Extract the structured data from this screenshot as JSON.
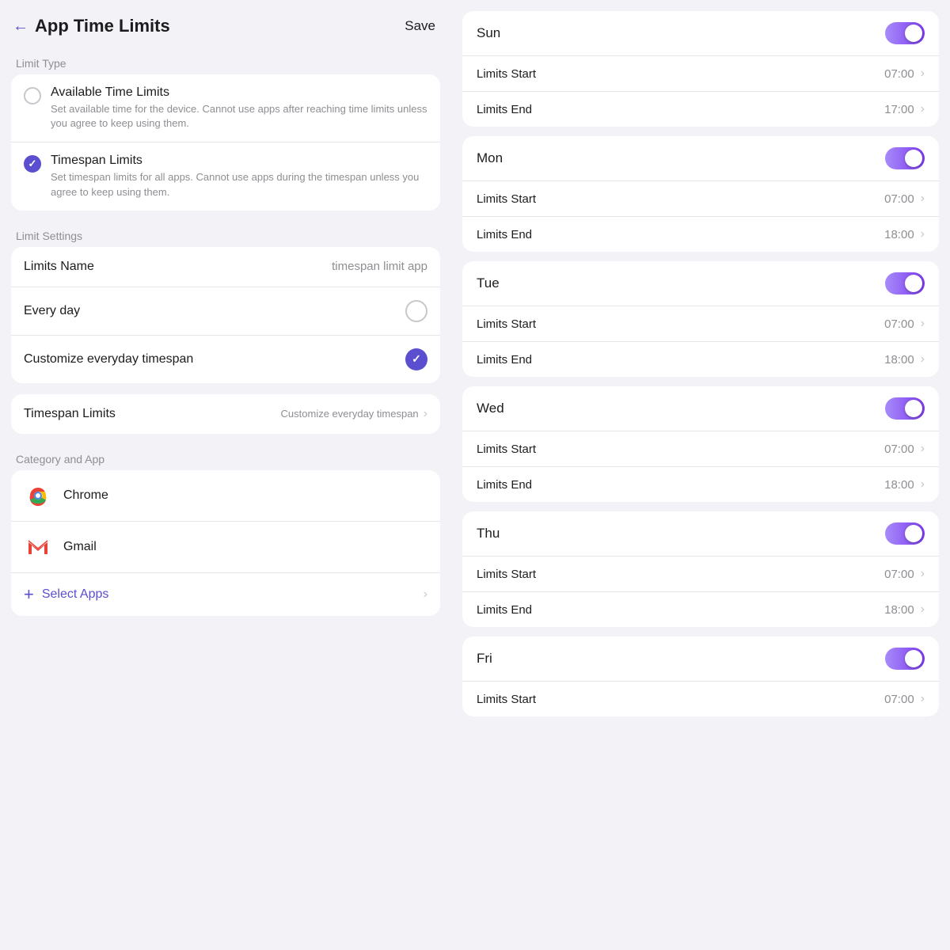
{
  "header": {
    "title": "App Time Limits",
    "save_label": "Save",
    "back_label": "←"
  },
  "limit_type": {
    "section_label": "Limit Type",
    "options": [
      {
        "title": "Available Time Limits",
        "desc": "Set available time for the device. Cannot use apps after reaching time limits unless you agree to keep using them.",
        "checked": false
      },
      {
        "title": "Timespan Limits",
        "desc": "Set timespan limits for all apps. Cannot use apps during the timespan unless you agree to keep using them.",
        "checked": true
      }
    ]
  },
  "limit_settings": {
    "section_label": "Limit Settings",
    "name_label": "Limits Name",
    "name_value": "timespan limit app",
    "every_day_label": "Every day",
    "customize_label": "Customize everyday timespan",
    "timespan_label": "Timespan Limits",
    "timespan_right": "Customize everyday timespan"
  },
  "category_app": {
    "section_label": "Category and App",
    "apps": [
      {
        "name": "Chrome"
      },
      {
        "name": "Gmail"
      }
    ],
    "select_label": "Select Apps"
  },
  "days": [
    {
      "name": "Sun",
      "enabled": true,
      "limits_start": "07:00",
      "limits_end": "17:00"
    },
    {
      "name": "Mon",
      "enabled": true,
      "limits_start": "07:00",
      "limits_end": "18:00"
    },
    {
      "name": "Tue",
      "enabled": true,
      "limits_start": "07:00",
      "limits_end": "18:00"
    },
    {
      "name": "Wed",
      "enabled": true,
      "limits_start": "07:00",
      "limits_end": "18:00"
    },
    {
      "name": "Thu",
      "enabled": true,
      "limits_start": "07:00",
      "limits_end": "18:00"
    },
    {
      "name": "Fri",
      "enabled": true,
      "limits_start": "07:00",
      "limits_end": null
    }
  ],
  "labels": {
    "limits_start": "Limits Start",
    "limits_end": "Limits End"
  }
}
